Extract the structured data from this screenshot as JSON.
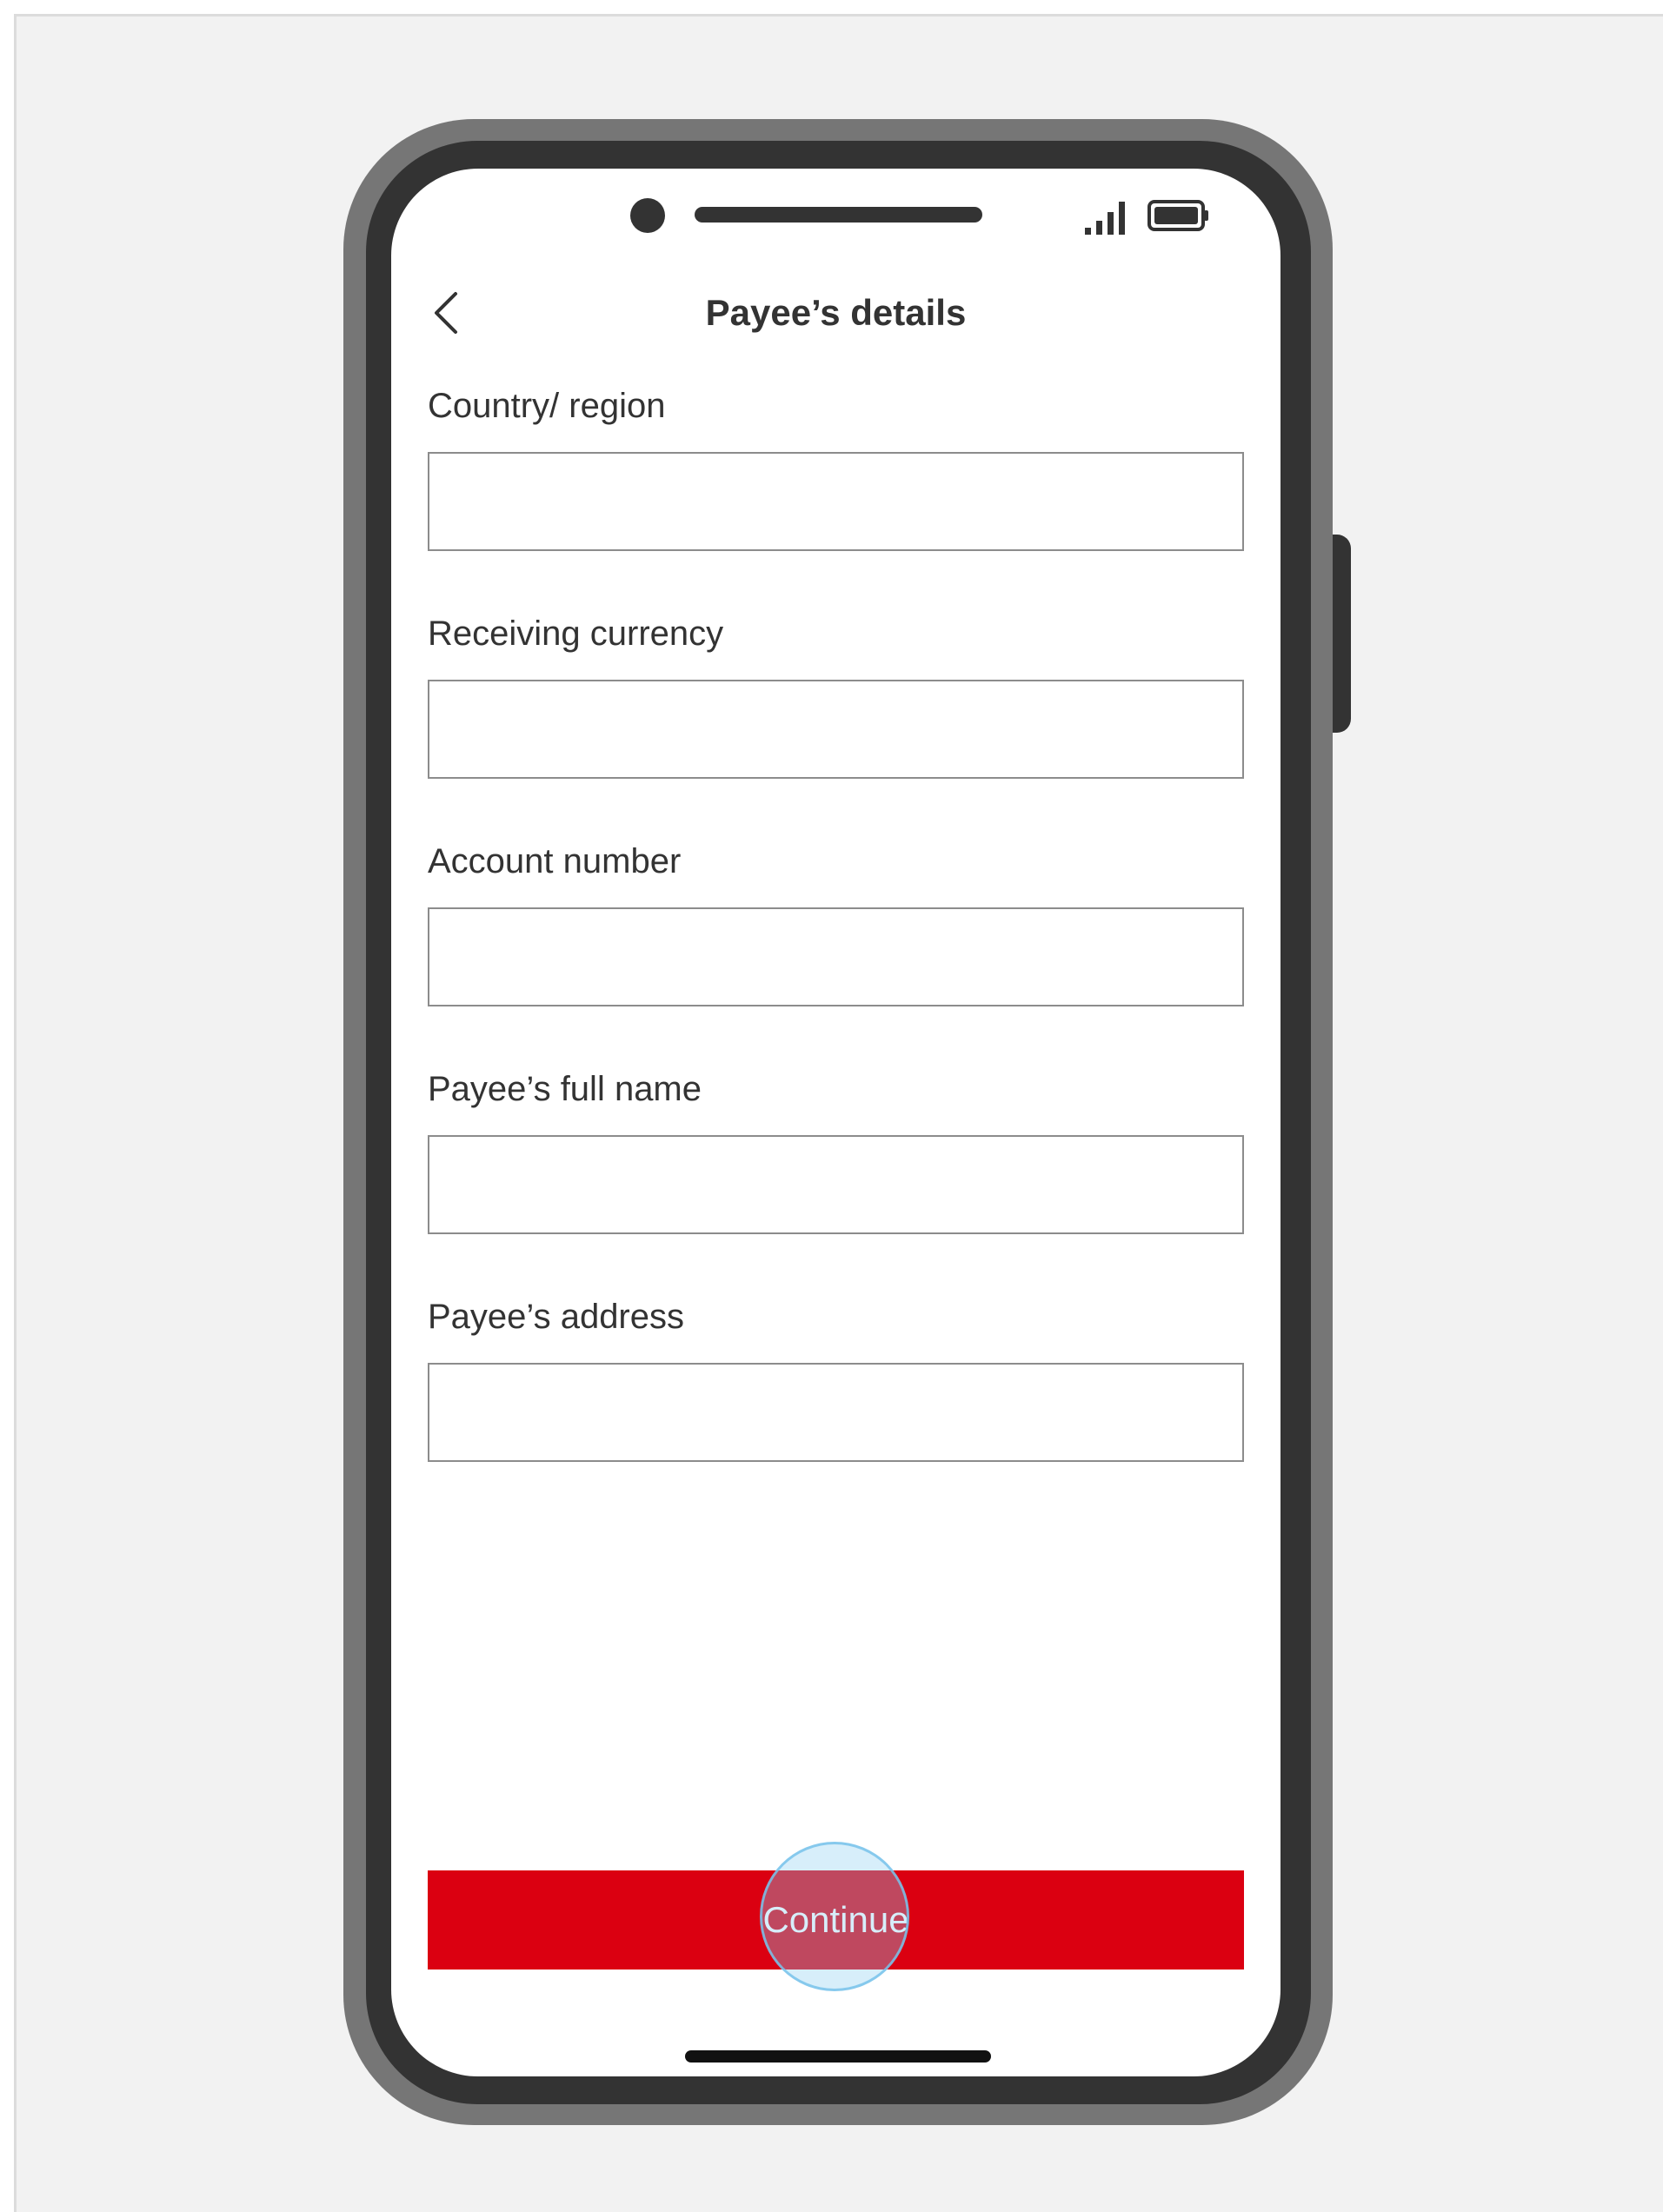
{
  "header": {
    "title": "Payee’s details",
    "back_icon": "chevron-left-icon"
  },
  "status_bar": {
    "icons": [
      "signal-icon",
      "battery-icon"
    ]
  },
  "form": {
    "fields": [
      {
        "label": "Country/ region",
        "value": ""
      },
      {
        "label": "Receiving currency",
        "value": ""
      },
      {
        "label": "Account number",
        "value": ""
      },
      {
        "label": "Payee’s full name",
        "value": ""
      },
      {
        "label": "Payee’s address",
        "value": ""
      }
    ],
    "continue_label": "Continue"
  },
  "colors": {
    "primary_button": "#db0011",
    "text": "#333333",
    "tap_indicator": "#8ccdf0"
  }
}
